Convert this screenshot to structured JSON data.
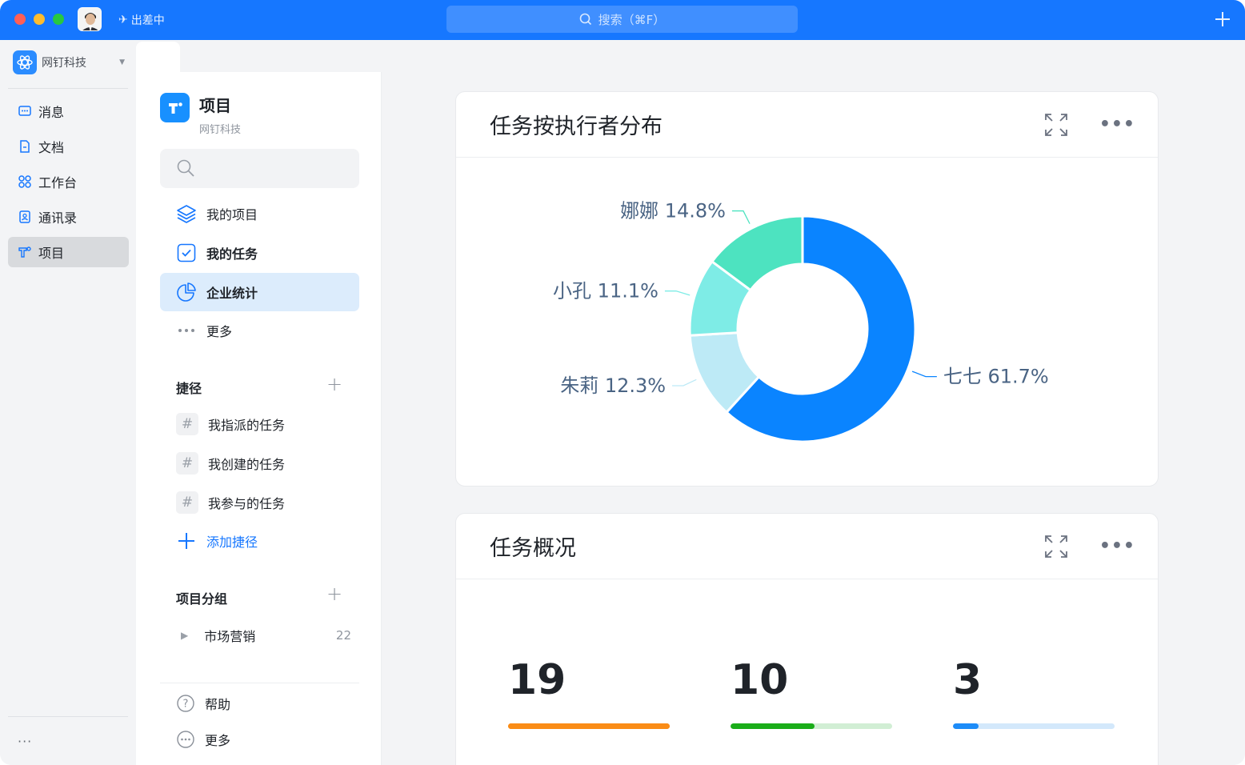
{
  "titlebar": {
    "status_text": "出差中",
    "search_placeholder": "搜索（⌘F）",
    "colors": {
      "bar": "#1677ff"
    }
  },
  "rail": {
    "org_name": "网钉科技",
    "items": [
      {
        "label": "消息",
        "icon": "message-icon"
      },
      {
        "label": "文档",
        "icon": "document-icon"
      },
      {
        "label": "工作台",
        "icon": "workbench-icon"
      },
      {
        "label": "通讯录",
        "icon": "contacts-icon"
      },
      {
        "label": "项目",
        "icon": "project-icon",
        "active": true
      }
    ],
    "more": "···"
  },
  "nav": {
    "title": "项目",
    "subtitle": "网钉科技",
    "items": [
      {
        "label": "我的项目",
        "icon": "layers-icon"
      },
      {
        "label": "我的任务",
        "icon": "task-check-icon"
      },
      {
        "label": "企业统计",
        "icon": "pie-chart-icon",
        "active": true
      },
      {
        "label": "更多",
        "icon": "ellipsis-icon"
      }
    ],
    "shortcuts": {
      "title": "捷径",
      "items": [
        "我指派的任务",
        "我创建的任务",
        "我参与的任务"
      ],
      "add_label": "添加捷径"
    },
    "groups": {
      "title": "项目分组",
      "items": [
        {
          "name": "市场营销",
          "count": "22"
        }
      ]
    },
    "footer": [
      {
        "label": "帮助",
        "icon": "help-icon"
      },
      {
        "label": "更多",
        "icon": "more-circle-icon"
      }
    ]
  },
  "cards": {
    "distribution": {
      "title": "任务按执行者分布"
    },
    "overview": {
      "title": "任务概况",
      "stats": [
        {
          "value": "19",
          "fill": 1.0,
          "color": "#fa8c16",
          "track": "#fa8c16"
        },
        {
          "value": "10",
          "fill": 0.52,
          "color": "#1aad19",
          "track": "#d1eed4"
        },
        {
          "value": "3",
          "fill": 0.16,
          "color": "#1d8cf8",
          "track": "#d3e8fb"
        }
      ]
    }
  },
  "chart_data": {
    "type": "pie",
    "donut": true,
    "slices": [
      {
        "name": "七七",
        "value": 61.7,
        "label": "七七 61.7%",
        "color": "#0a84ff"
      },
      {
        "name": "朱莉",
        "value": 12.3,
        "label": "朱莉 12.3%",
        "color": "#bdeaf6"
      },
      {
        "name": "小孔",
        "value": 11.1,
        "label": "小孔 11.1%",
        "color": "#7eece6"
      },
      {
        "name": "娜娜",
        "value": 14.8,
        "label": "娜娜 14.8%",
        "color": "#4de3c0"
      }
    ]
  }
}
